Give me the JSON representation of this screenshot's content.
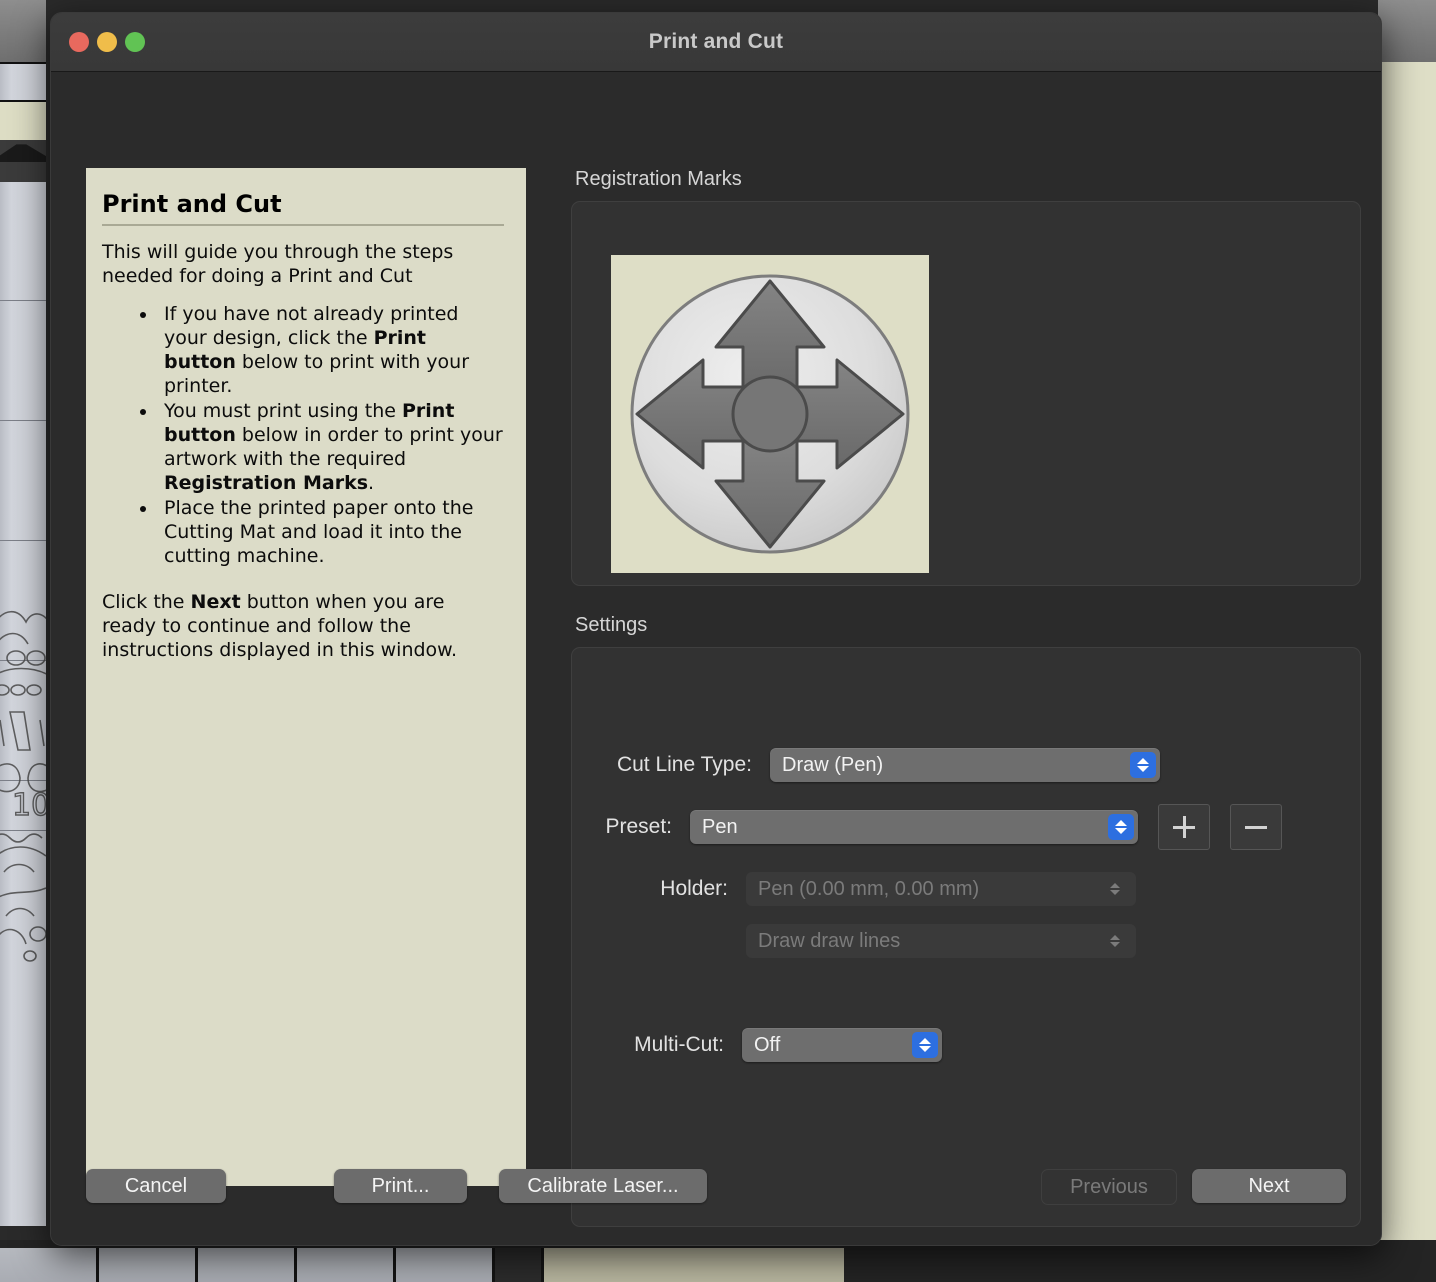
{
  "window": {
    "title": "Print and Cut",
    "traffic_lights": [
      {
        "name": "close",
        "color": "#e8695e"
      },
      {
        "name": "minimize",
        "color": "#f0bd4a"
      },
      {
        "name": "maximize",
        "color": "#61c354"
      }
    ]
  },
  "instructions": {
    "title": "Print and Cut",
    "intro": "This will guide you through the steps needed for doing a Print and Cut",
    "bullets": [
      "If you have not already printed your design, click the Print button below to print with your printer.",
      "You must print using the Print button below in order to print your artwork with the required Registration Marks.",
      "Place the printed paper onto the Cutting Mat and load it into the cutting machine."
    ],
    "bullets_html": [
      "If you have not already printed your design, click the <b>Print button</b> below to print with your printer.",
      "You must print using the <b>Print button</b> below in order to print your artwork with the required <b>Registration Marks</b>.",
      "Place the printed paper onto the Cutting Mat and load it into the cutting machine."
    ],
    "outro": "Click the Next button when you are ready to continue and follow the instructions displayed in this window.",
    "outro_html": "Click the <b>Next</b> button when you are ready to continue and follow the instructions displayed in this window."
  },
  "registration_marks": {
    "group_label": "Registration Marks",
    "image_name": "dpad-registration-mark-preview",
    "image_bg": "#dedec6",
    "circle_color": "#d8d8d8",
    "arrow_color": "#6f6f6f"
  },
  "settings": {
    "group_label": "Settings",
    "cut_line_type": {
      "label": "Cut Line Type:",
      "value": "Draw (Pen)",
      "enabled": true
    },
    "preset": {
      "label": "Preset:",
      "value": "Pen",
      "enabled": true,
      "add_button": "+",
      "remove_button": "—"
    },
    "holder": {
      "label": "Holder:",
      "value": "Pen (0.00 mm, 0.00 mm)",
      "enabled": false
    },
    "line_mode": {
      "value": "Draw draw lines",
      "enabled": false
    },
    "multi_cut": {
      "label": "Multi-Cut:",
      "value": "Off",
      "enabled": true
    }
  },
  "buttons": {
    "cancel": "Cancel",
    "print": "Print...",
    "calibrate_laser": "Calibrate Laser...",
    "previous": "Previous",
    "next": "Next",
    "previous_enabled": false
  },
  "colors": {
    "dialog_bg": "#2b2b2b",
    "panel_bg": "#dcdcc8",
    "accent_blue": "#2d6fe0",
    "group_bg": "#323232"
  }
}
